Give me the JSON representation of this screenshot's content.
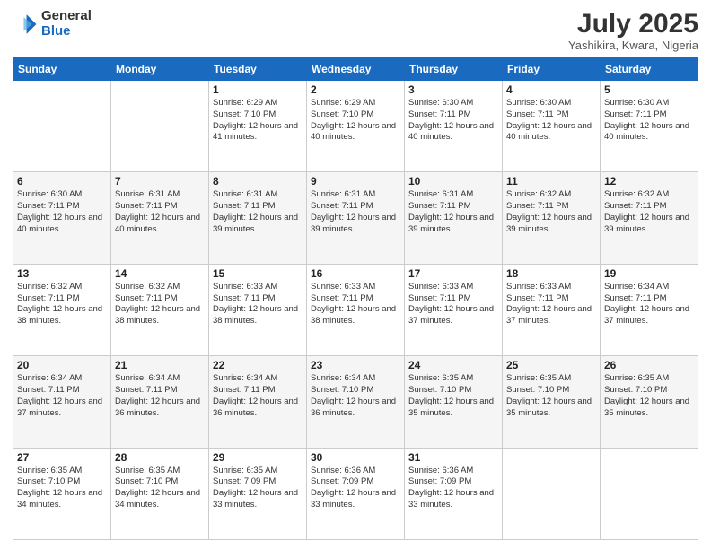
{
  "header": {
    "logo_general": "General",
    "logo_blue": "Blue",
    "month_title": "July 2025",
    "location": "Yashikira, Kwara, Nigeria"
  },
  "days_of_week": [
    "Sunday",
    "Monday",
    "Tuesday",
    "Wednesday",
    "Thursday",
    "Friday",
    "Saturday"
  ],
  "weeks": [
    [
      {
        "day": "",
        "info": ""
      },
      {
        "day": "",
        "info": ""
      },
      {
        "day": "1",
        "info": "Sunrise: 6:29 AM\nSunset: 7:10 PM\nDaylight: 12 hours and 41 minutes."
      },
      {
        "day": "2",
        "info": "Sunrise: 6:29 AM\nSunset: 7:10 PM\nDaylight: 12 hours and 40 minutes."
      },
      {
        "day": "3",
        "info": "Sunrise: 6:30 AM\nSunset: 7:11 PM\nDaylight: 12 hours and 40 minutes."
      },
      {
        "day": "4",
        "info": "Sunrise: 6:30 AM\nSunset: 7:11 PM\nDaylight: 12 hours and 40 minutes."
      },
      {
        "day": "5",
        "info": "Sunrise: 6:30 AM\nSunset: 7:11 PM\nDaylight: 12 hours and 40 minutes."
      }
    ],
    [
      {
        "day": "6",
        "info": "Sunrise: 6:30 AM\nSunset: 7:11 PM\nDaylight: 12 hours and 40 minutes."
      },
      {
        "day": "7",
        "info": "Sunrise: 6:31 AM\nSunset: 7:11 PM\nDaylight: 12 hours and 40 minutes."
      },
      {
        "day": "8",
        "info": "Sunrise: 6:31 AM\nSunset: 7:11 PM\nDaylight: 12 hours and 39 minutes."
      },
      {
        "day": "9",
        "info": "Sunrise: 6:31 AM\nSunset: 7:11 PM\nDaylight: 12 hours and 39 minutes."
      },
      {
        "day": "10",
        "info": "Sunrise: 6:31 AM\nSunset: 7:11 PM\nDaylight: 12 hours and 39 minutes."
      },
      {
        "day": "11",
        "info": "Sunrise: 6:32 AM\nSunset: 7:11 PM\nDaylight: 12 hours and 39 minutes."
      },
      {
        "day": "12",
        "info": "Sunrise: 6:32 AM\nSunset: 7:11 PM\nDaylight: 12 hours and 39 minutes."
      }
    ],
    [
      {
        "day": "13",
        "info": "Sunrise: 6:32 AM\nSunset: 7:11 PM\nDaylight: 12 hours and 38 minutes."
      },
      {
        "day": "14",
        "info": "Sunrise: 6:32 AM\nSunset: 7:11 PM\nDaylight: 12 hours and 38 minutes."
      },
      {
        "day": "15",
        "info": "Sunrise: 6:33 AM\nSunset: 7:11 PM\nDaylight: 12 hours and 38 minutes."
      },
      {
        "day": "16",
        "info": "Sunrise: 6:33 AM\nSunset: 7:11 PM\nDaylight: 12 hours and 38 minutes."
      },
      {
        "day": "17",
        "info": "Sunrise: 6:33 AM\nSunset: 7:11 PM\nDaylight: 12 hours and 37 minutes."
      },
      {
        "day": "18",
        "info": "Sunrise: 6:33 AM\nSunset: 7:11 PM\nDaylight: 12 hours and 37 minutes."
      },
      {
        "day": "19",
        "info": "Sunrise: 6:34 AM\nSunset: 7:11 PM\nDaylight: 12 hours and 37 minutes."
      }
    ],
    [
      {
        "day": "20",
        "info": "Sunrise: 6:34 AM\nSunset: 7:11 PM\nDaylight: 12 hours and 37 minutes."
      },
      {
        "day": "21",
        "info": "Sunrise: 6:34 AM\nSunset: 7:11 PM\nDaylight: 12 hours and 36 minutes."
      },
      {
        "day": "22",
        "info": "Sunrise: 6:34 AM\nSunset: 7:11 PM\nDaylight: 12 hours and 36 minutes."
      },
      {
        "day": "23",
        "info": "Sunrise: 6:34 AM\nSunset: 7:10 PM\nDaylight: 12 hours and 36 minutes."
      },
      {
        "day": "24",
        "info": "Sunrise: 6:35 AM\nSunset: 7:10 PM\nDaylight: 12 hours and 35 minutes."
      },
      {
        "day": "25",
        "info": "Sunrise: 6:35 AM\nSunset: 7:10 PM\nDaylight: 12 hours and 35 minutes."
      },
      {
        "day": "26",
        "info": "Sunrise: 6:35 AM\nSunset: 7:10 PM\nDaylight: 12 hours and 35 minutes."
      }
    ],
    [
      {
        "day": "27",
        "info": "Sunrise: 6:35 AM\nSunset: 7:10 PM\nDaylight: 12 hours and 34 minutes."
      },
      {
        "day": "28",
        "info": "Sunrise: 6:35 AM\nSunset: 7:10 PM\nDaylight: 12 hours and 34 minutes."
      },
      {
        "day": "29",
        "info": "Sunrise: 6:35 AM\nSunset: 7:09 PM\nDaylight: 12 hours and 33 minutes."
      },
      {
        "day": "30",
        "info": "Sunrise: 6:36 AM\nSunset: 7:09 PM\nDaylight: 12 hours and 33 minutes."
      },
      {
        "day": "31",
        "info": "Sunrise: 6:36 AM\nSunset: 7:09 PM\nDaylight: 12 hours and 33 minutes."
      },
      {
        "day": "",
        "info": ""
      },
      {
        "day": "",
        "info": ""
      }
    ]
  ]
}
